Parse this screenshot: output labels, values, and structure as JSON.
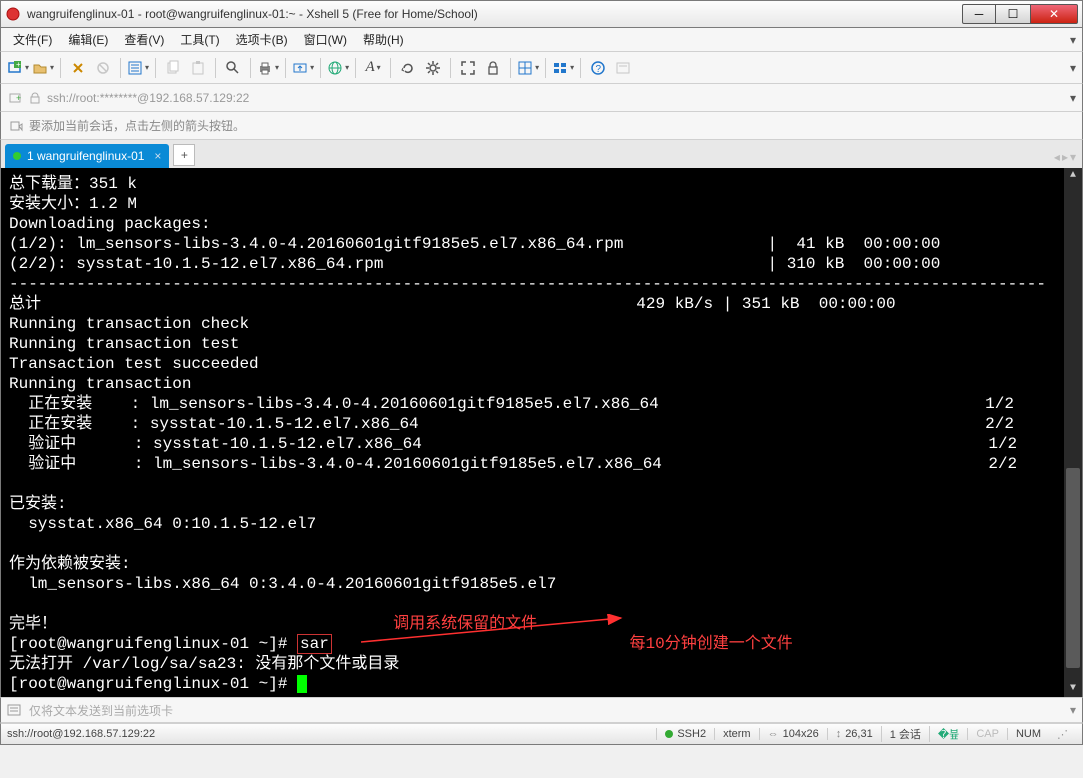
{
  "window": {
    "title": "wangruifenglinux-01 - root@wangruifenglinux-01:~ - Xshell 5 (Free for Home/School)"
  },
  "menu": {
    "items": [
      "文件(F)",
      "编辑(E)",
      "查看(V)",
      "工具(T)",
      "选项卡(B)",
      "窗口(W)",
      "帮助(H)"
    ]
  },
  "address": {
    "url": "ssh://root:********@192.168.57.129:22"
  },
  "hint": {
    "text": "要添加当前会话，点击左侧的箭头按钮。"
  },
  "tab": {
    "label": "1 wangruifenglinux-01"
  },
  "terminal": {
    "line1": "总下载量：351 k",
    "line2": "安装大小：1.2 M",
    "line3": "Downloading packages:",
    "line4": "(1/2): lm_sensors-libs-3.4.0-4.20160601gitf9185e5.el7.x86_64.rpm               |  41 kB  00:00:00",
    "line5": "(2/2): sysstat-10.1.5-12.el7.x86_64.rpm                                        | 310 kB  00:00:00",
    "dash": "------------------------------------------------------------------------------------------------------------",
    "line6": "总计                                                              429 kB/s | 351 kB  00:00:00",
    "line7": "Running transaction check",
    "line8": "Running transaction test",
    "line9": "Transaction test succeeded",
    "line10": "Running transaction",
    "line11": "  正在安装    : lm_sensors-libs-3.4.0-4.20160601gitf9185e5.el7.x86_64                                  1/2",
    "line12": "  正在安装    : sysstat-10.1.5-12.el7.x86_64                                                           2/2",
    "line13": "  验证中      : sysstat-10.1.5-12.el7.x86_64                                                           1/2",
    "line14": "  验证中      : lm_sensors-libs-3.4.0-4.20160601gitf9185e5.el7.x86_64                                  2/2",
    "line15": "",
    "line16": "已安装:",
    "line17": "  sysstat.x86_64 0:10.1.5-12.el7",
    "line18": "",
    "line19": "作为依赖被安装:",
    "line20": "  lm_sensors-libs.x86_64 0:3.4.0-4.20160601gitf9185e5.el7",
    "line21": "",
    "line22": "完毕！",
    "prompt1_a": "[root@wangruifenglinux-01 ~]# ",
    "prompt1_cmd": "sar",
    "line24": "无法打开 /var/log/sa/sa23: 没有那个文件或目录",
    "prompt2": "[root@wangruifenglinux-01 ~]# ",
    "ann1": "调用系统保留的文件",
    "ann2": "每10分钟创建一个文件"
  },
  "sendbar": {
    "placeholder": "仅将文本发送到当前选项卡"
  },
  "status": {
    "left": "ssh://root@192.168.57.129:22",
    "ssh": "SSH2",
    "term": "xterm",
    "size": "104x26",
    "pos": "26,31",
    "sess": "1 会话",
    "cap": "CAP",
    "num": "NUM"
  }
}
